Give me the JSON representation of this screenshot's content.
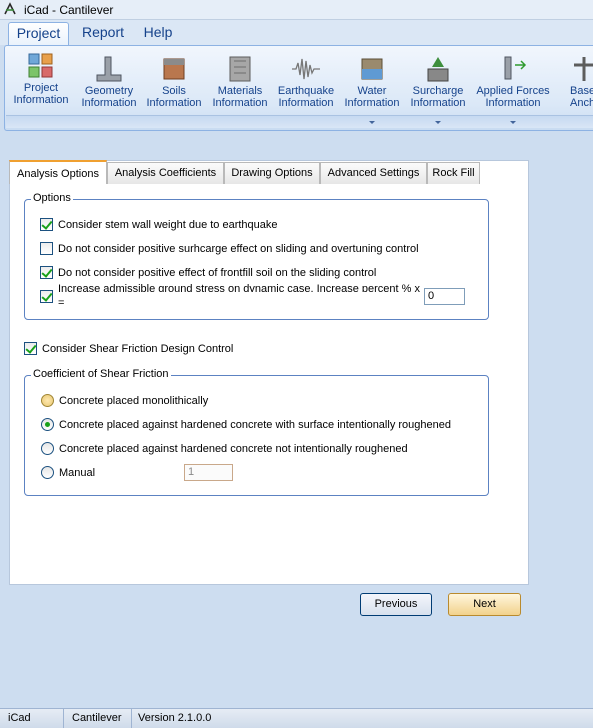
{
  "window": {
    "title": "iCad - Cantilever"
  },
  "menu": {
    "tabs": [
      "Project",
      "Report",
      "Help"
    ]
  },
  "ribbon": {
    "items": [
      {
        "line1": "Project",
        "line2": "Information",
        "icon": "project-info-icon"
      },
      {
        "line1": "Geometry",
        "line2": "Information",
        "icon": "geometry-icon"
      },
      {
        "line1": "Soils",
        "line2": "Information",
        "icon": "soils-icon"
      },
      {
        "line1": "Materials",
        "line2": "Information",
        "icon": "materials-icon"
      },
      {
        "line1": "Earthquake",
        "line2": "Information",
        "icon": "earthquake-icon"
      },
      {
        "line1": "Water",
        "line2": "Information",
        "icon": "water-icon"
      },
      {
        "line1": "Surcharge",
        "line2": "Information",
        "icon": "surcharge-icon"
      },
      {
        "line1": "Applied Forces",
        "line2": "Information",
        "icon": "applied-forces-icon"
      },
      {
        "line1": "Base",
        "line2": "Anchor",
        "icon": "base-anchor-icon"
      }
    ]
  },
  "tabs": [
    "Analysis Options",
    "Analysis Coefficients",
    "Drawing Options",
    "Advanced Settings",
    "Rock Fill"
  ],
  "options_group": {
    "title": "Options",
    "items": [
      {
        "label": "Consider stem wall weight due to earthquake",
        "checked": true
      },
      {
        "label": "Do not consider positive surhcarge effect on sliding and overtuning control",
        "checked": false
      },
      {
        "label": "Do not consider positive effect of frontfill soil on the sliding control",
        "checked": true
      },
      {
        "label": "Increase admissible ground stress on dynamic case. Increase percent % x",
        "label_line2": "=",
        "checked": true,
        "value": "0"
      }
    ]
  },
  "shear_friction": {
    "label": "Consider Shear Friction Design Control",
    "checked": true
  },
  "coef_group": {
    "title": "Coefficient of  Shear Friction",
    "items": [
      {
        "label": "Concrete placed monolithically",
        "selected": false
      },
      {
        "label": "Concrete placed against hardened concrete with surface intentionally roughened",
        "selected": true
      },
      {
        "label": "Concrete placed against hardened  concrete not intentionally roughened",
        "selected": false
      },
      {
        "label": "Manual",
        "selected": false
      }
    ],
    "manual_value": "1"
  },
  "buttons": {
    "previous": "Previous",
    "next": "Next"
  },
  "status": {
    "app": "iCad",
    "module": "Cantilever",
    "version": "Version 2.1.0.0"
  }
}
